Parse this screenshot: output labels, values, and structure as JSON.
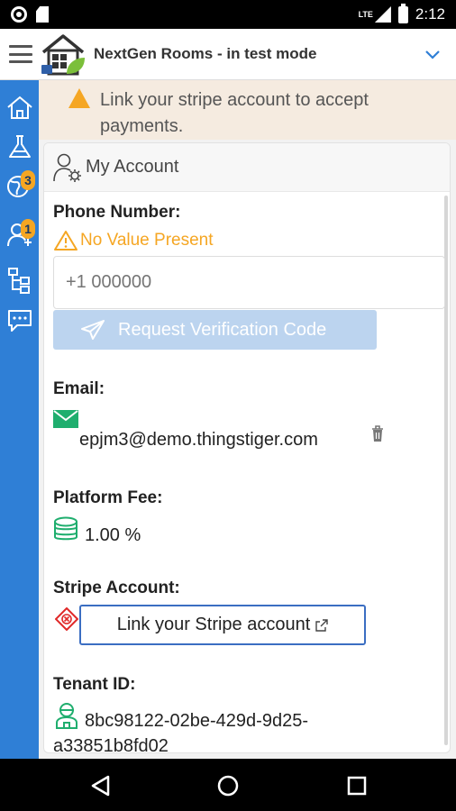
{
  "status_bar": {
    "time": "2:12",
    "network": "LTE"
  },
  "header": {
    "title": "NextGen Rooms - in test mode"
  },
  "rail": {
    "items": [
      {
        "icon": "home-icon"
      },
      {
        "icon": "flask-icon"
      },
      {
        "icon": "globe-user-icon",
        "badge": "3"
      },
      {
        "icon": "user-add-icon",
        "badge": "1"
      },
      {
        "icon": "hierarchy-icon"
      },
      {
        "icon": "chat-icon"
      }
    ]
  },
  "warning": {
    "text": "Link your stripe account to accept payments."
  },
  "card": {
    "title": "My Account",
    "phone": {
      "label": "Phone Number:",
      "status": "No Value Present",
      "placeholder": "+1 000000",
      "verify_label": "Request Verification Code"
    },
    "email": {
      "label": "Email:",
      "value": "epjm3@demo.thingstiger.com"
    },
    "platform_fee": {
      "label": "Platform Fee:",
      "value": "1.00 %"
    },
    "stripe": {
      "label": "Stripe Account:",
      "button_label": "Link your Stripe account"
    },
    "tenant": {
      "label": "Tenant ID:",
      "value_line1": "8bc98122-02be-429d-9d25-",
      "value_line2": "a33851b8fd02"
    }
  },
  "colors": {
    "rail": "#2f7fd6",
    "warning": "#f5a623",
    "success": "#1fae6e",
    "error": "#e02828",
    "link_border": "#3b6ec2"
  }
}
